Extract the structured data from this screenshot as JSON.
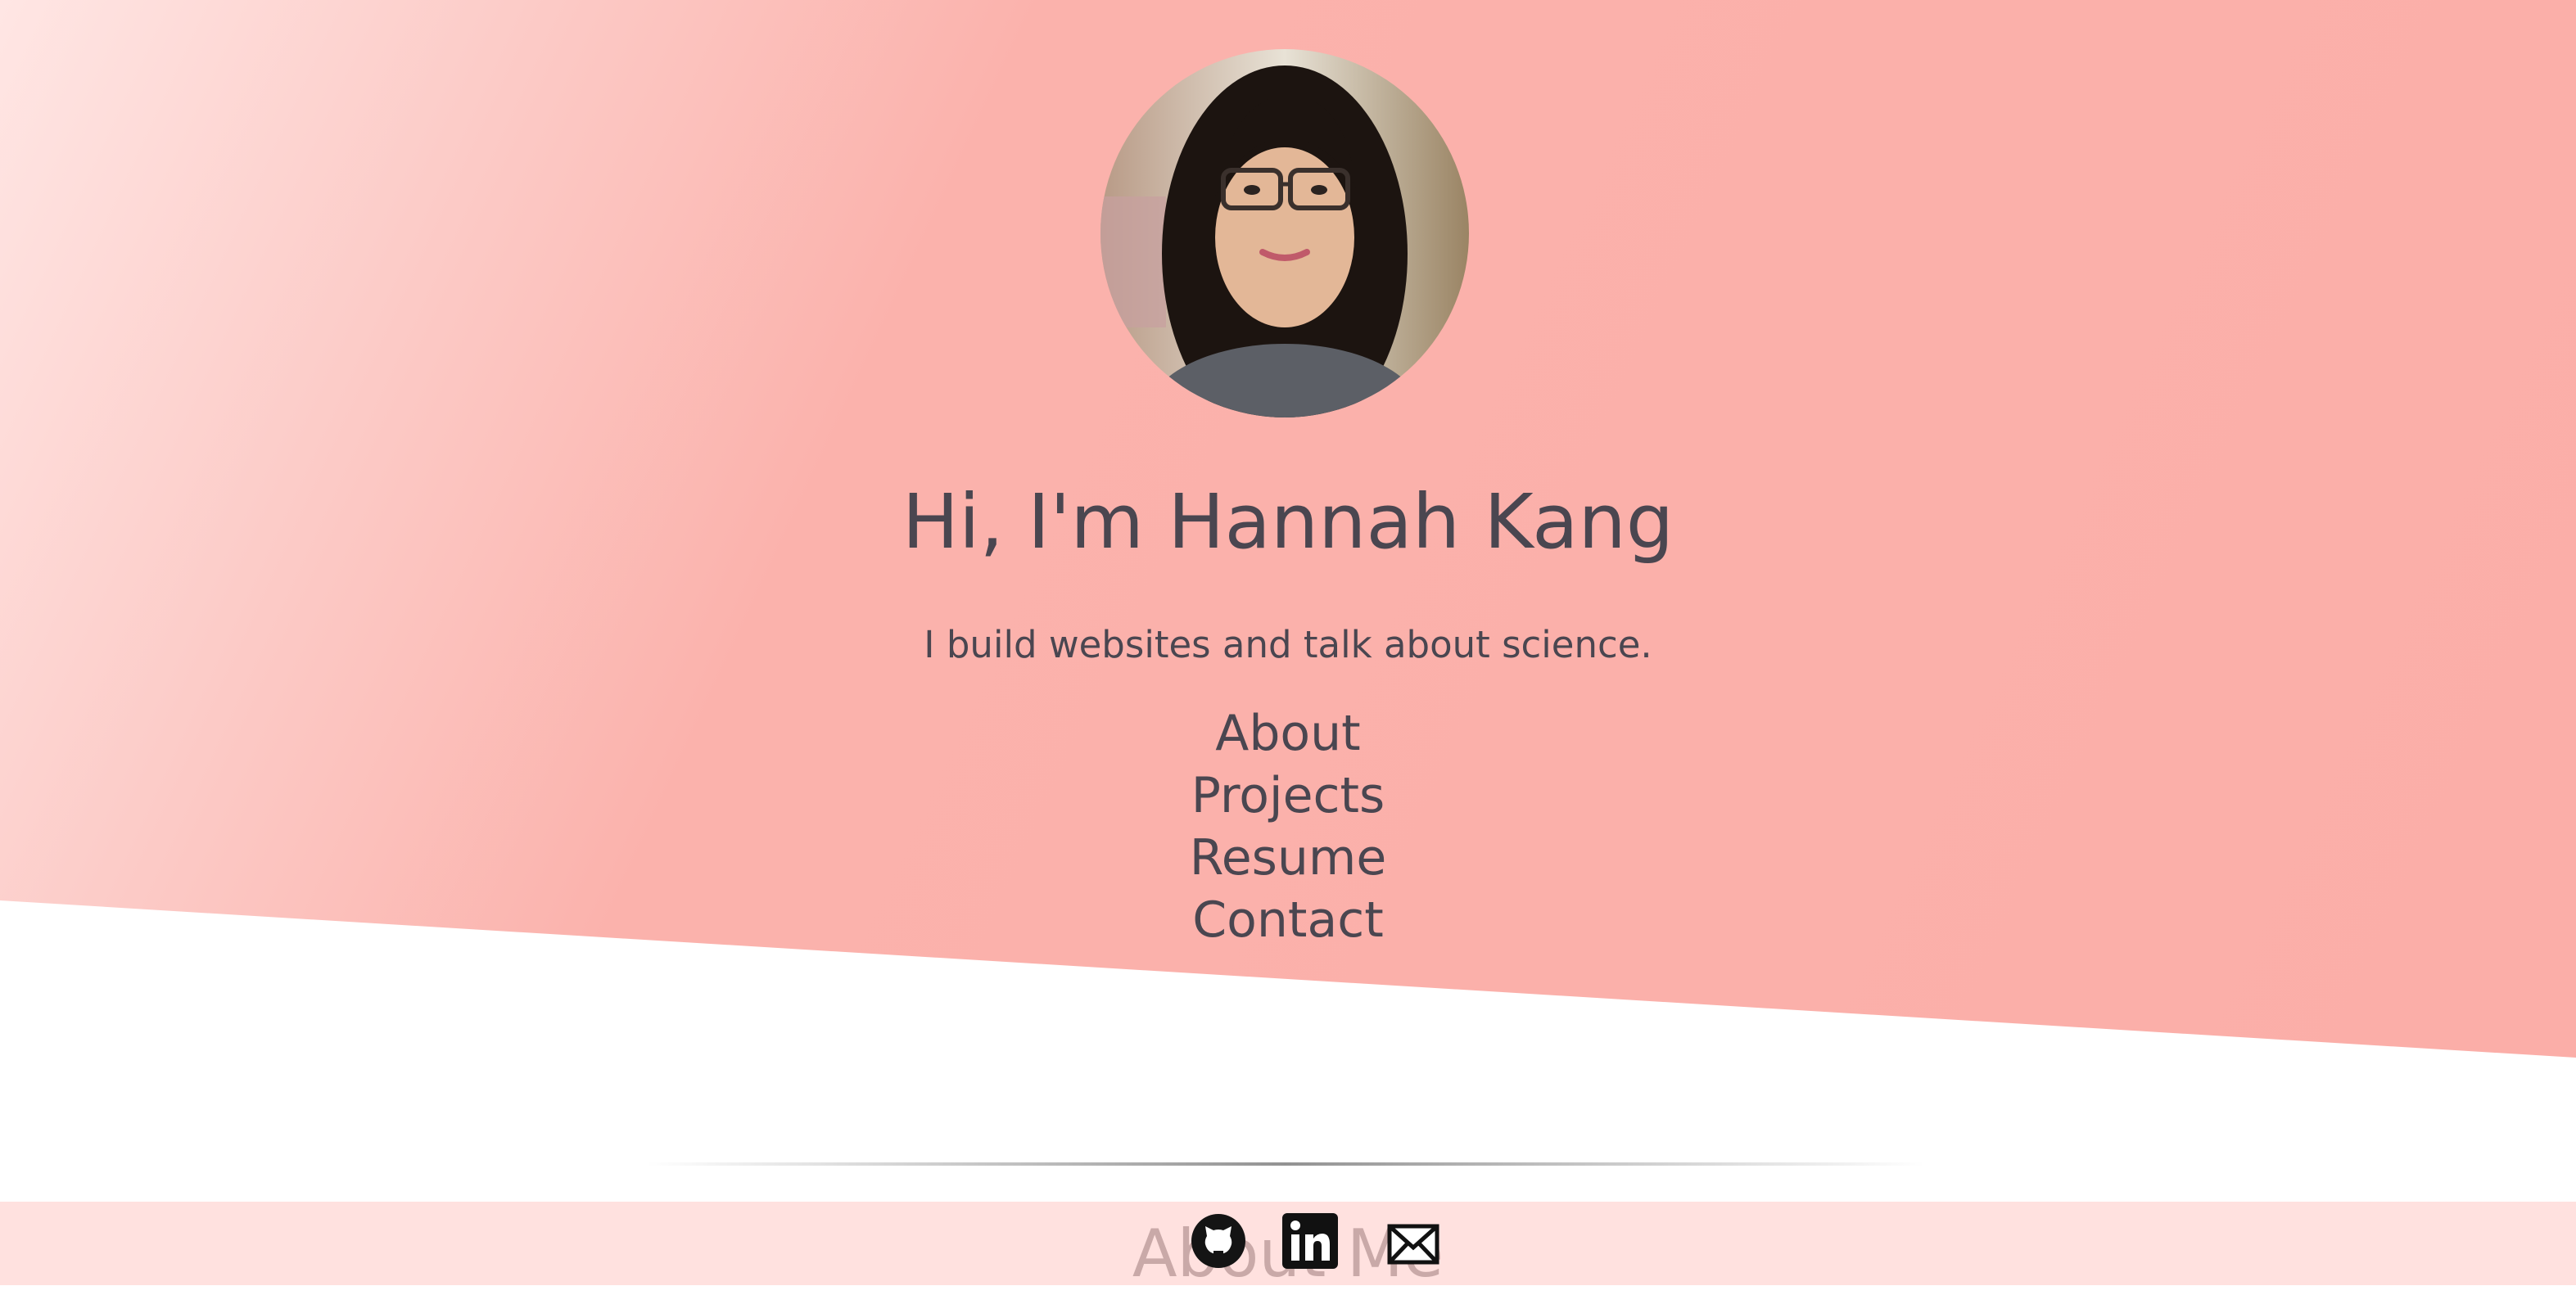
{
  "hero": {
    "name": "Hi, I'm Hannah Kang",
    "tagline": "I build websites and talk about science.",
    "nav": [
      "About",
      "Projects",
      "Resume",
      "Contact"
    ]
  },
  "footer": {
    "section_heading": "About Me",
    "social_icons": [
      "github-icon",
      "linkedin-icon",
      "email-icon"
    ]
  },
  "colors": {
    "hero_bg": "#fbaea8",
    "hero_bg_light": "#ffe6e4",
    "text": "#4a4650",
    "footer_band": "#ffe1df"
  }
}
